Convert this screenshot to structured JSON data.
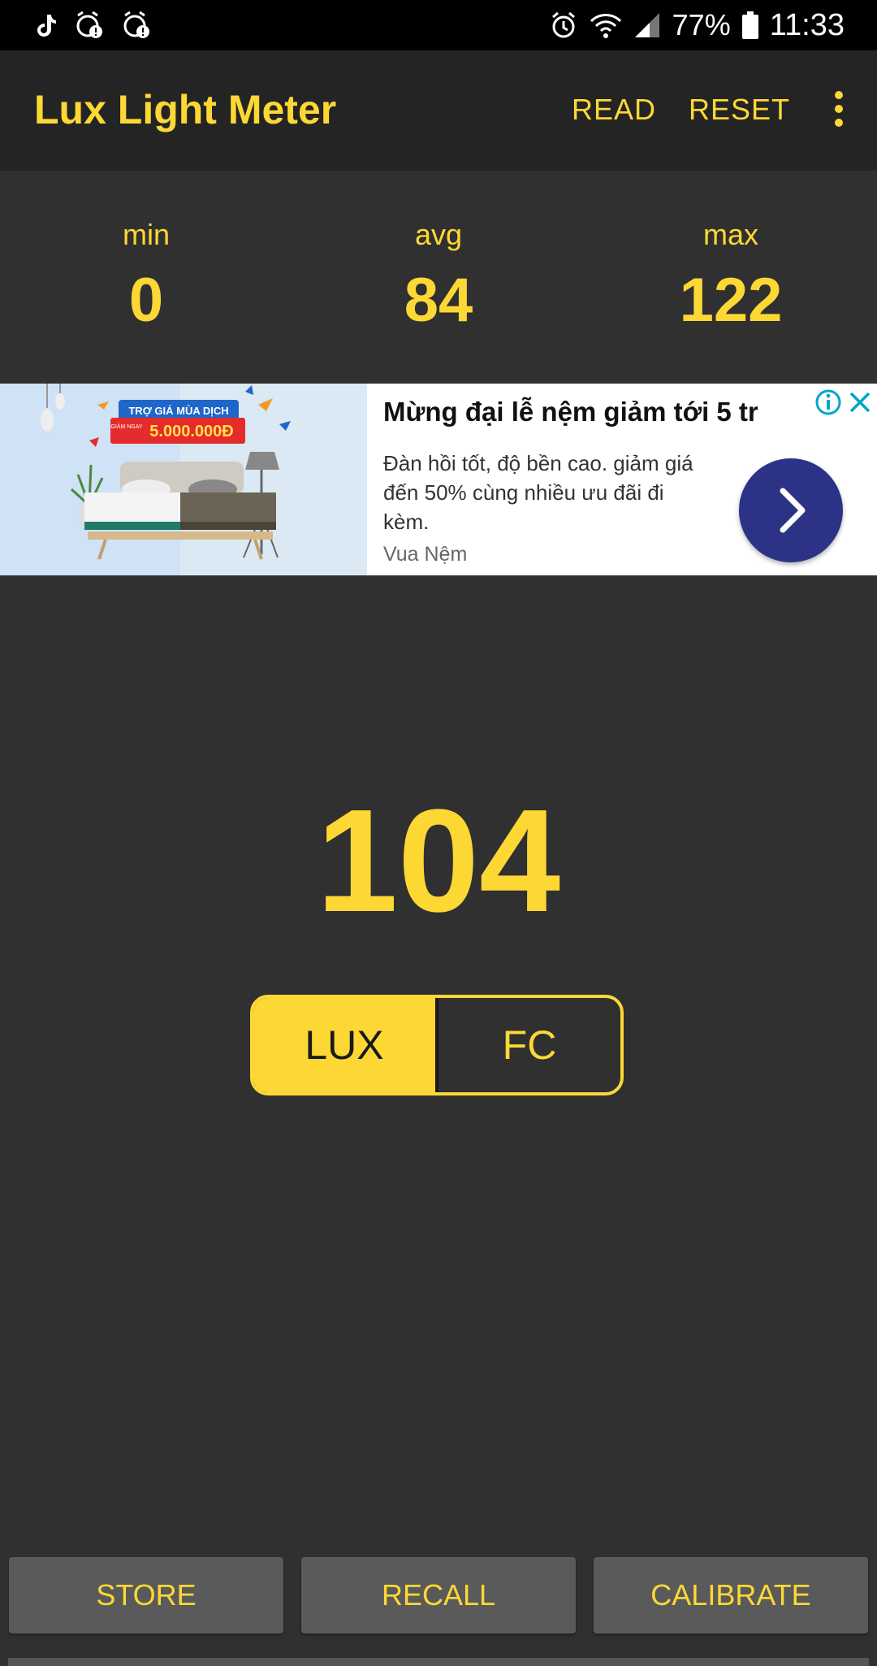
{
  "status_bar": {
    "battery": "77%",
    "time": "11:33"
  },
  "app_bar": {
    "title": "Lux Light Meter",
    "read_label": "READ",
    "reset_label": "RESET"
  },
  "stats": {
    "min_label": "min",
    "min_value": "0",
    "avg_label": "avg",
    "avg_value": "84",
    "max_label": "max",
    "max_value": "122"
  },
  "ad": {
    "banner_text": "TRỢ GIÁ MÙA DỊCH",
    "banner_sub": "GIẢM NGAY",
    "banner_amount": "5.000.000Đ",
    "title": "Mừng đại lễ nệm giảm tới 5 tr",
    "body": "Đàn hồi tốt, độ bền cao. giảm giá đến 50% cùng nhiều ưu đãi đi kèm.",
    "source": "Vua Nệm"
  },
  "reading": "104",
  "units": {
    "lux": "LUX",
    "fc": "FC",
    "selected": "LUX"
  },
  "buttons": {
    "store": "STORE",
    "recall": "RECALL",
    "calibrate": "CALIBRATE"
  },
  "colors": {
    "accent": "#fdd835",
    "background": "#303030",
    "appbar": "#242424",
    "button": "#5a5a5a",
    "ad_button": "#2c3285"
  }
}
